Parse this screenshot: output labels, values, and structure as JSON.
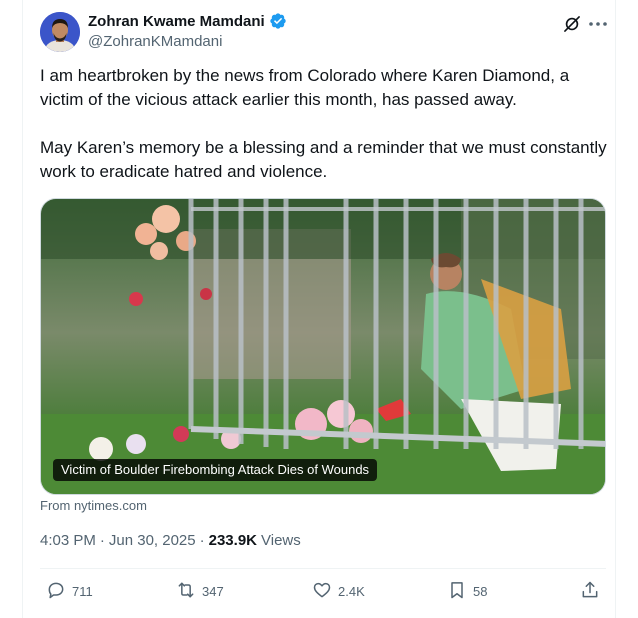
{
  "author": {
    "display_name": "Zohran Kwame Mamdani",
    "handle": "@ZohranKMamdani",
    "verified": true
  },
  "icons": {
    "verified": "verified-badge-icon",
    "grok": "grok-icon",
    "more": "more-options-icon",
    "reply": "reply-icon",
    "repost": "repost-icon",
    "like": "like-icon",
    "bookmark": "bookmark-icon",
    "share": "share-icon"
  },
  "tweet": {
    "text": "I am heartbroken by the news from Colorado where Karen Diamond, a victim of the vicious attack earlier this month, has passed away.\n\nMay Karen’s memory be a blessing and a reminder that we must constantly work to eradicate hatred and violence."
  },
  "media": {
    "caption": "Victim of Boulder Firebombing Attack Dies of Wounds",
    "source": "From nytimes.com"
  },
  "meta": {
    "time": "4:03 PM",
    "separator": "·",
    "date": "Jun 30, 2025",
    "views_count": "233.9K",
    "views_label": "Views"
  },
  "actions": {
    "replies": "711",
    "reposts": "347",
    "likes": "2.4K",
    "bookmarks": "58"
  },
  "colors": {
    "verified": "#1d9bf0",
    "secondary_text": "#536471",
    "primary_text": "#0f1419",
    "border": "#eff3f4"
  }
}
